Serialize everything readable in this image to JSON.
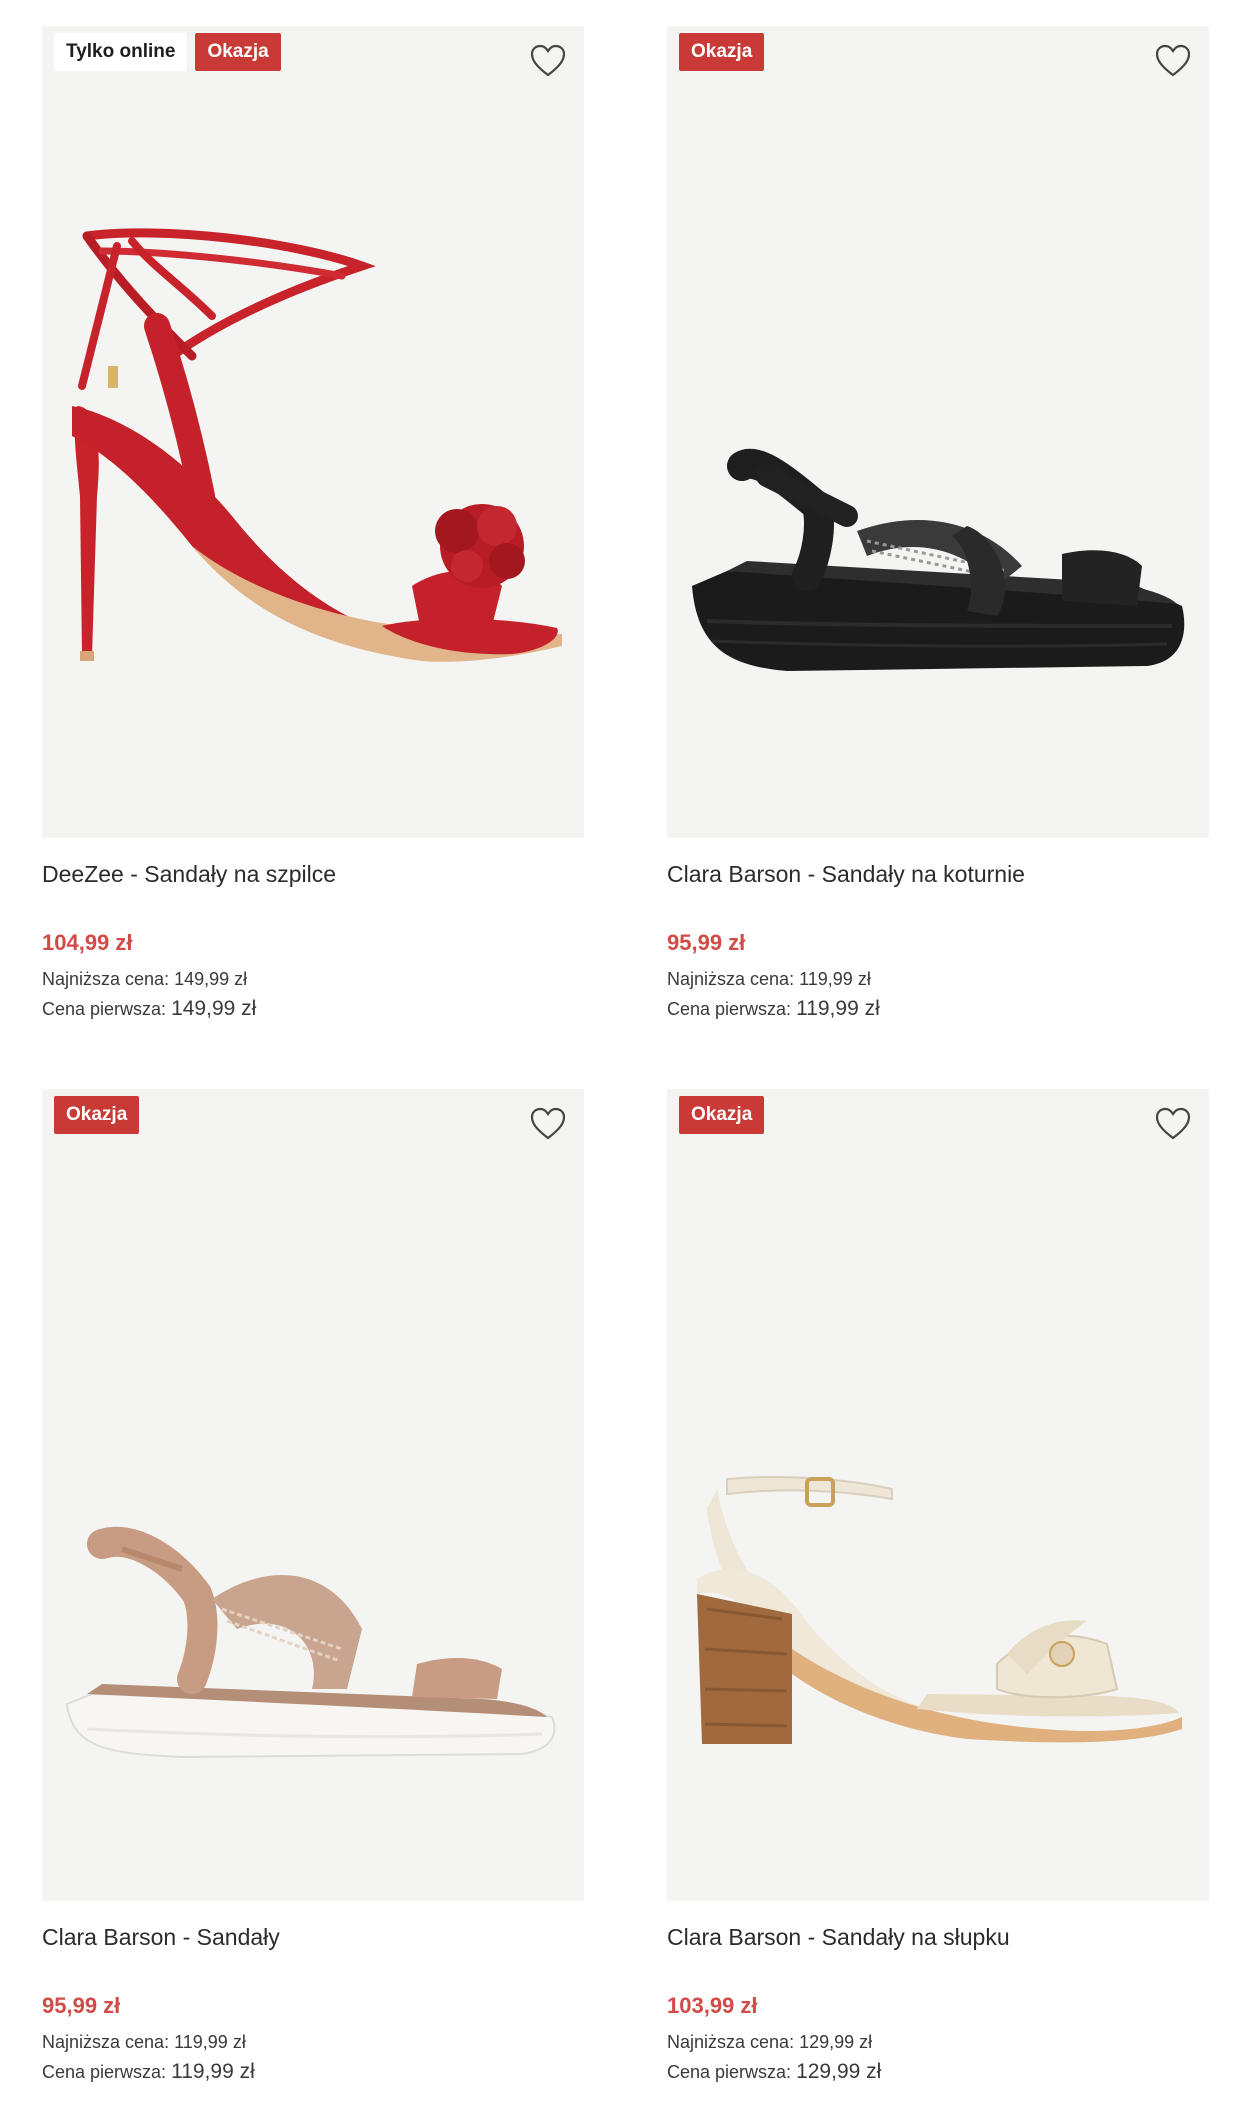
{
  "products": [
    {
      "name": "DeeZee - Sandały na szpilce",
      "badges": [
        "Tylko online",
        "Okazja"
      ],
      "price": "104,99 zł",
      "lowest_label": "Najniższa cena:",
      "lowest_value": "149,99 zł",
      "first_label": "Cena pierwsza:",
      "first_value": "149,99 zł",
      "favorite_icon": "heart-outline-icon"
    },
    {
      "name": "Clara Barson - Sandały na koturnie",
      "badges": [
        "Okazja"
      ],
      "price": "95,99 zł",
      "lowest_label": "Najniższa cena:",
      "lowest_value": "119,99 zł",
      "first_label": "Cena pierwsza:",
      "first_value": "119,99 zł",
      "favorite_icon": "heart-outline-icon"
    },
    {
      "name": "Clara Barson - Sandały",
      "badges": [
        "Okazja"
      ],
      "price": "95,99 zł",
      "lowest_label": "Najniższa cena:",
      "lowest_value": "119,99 zł",
      "first_label": "Cena pierwsza:",
      "first_value": "119,99 zł",
      "favorite_icon": "heart-outline-icon"
    },
    {
      "name": "Clara Barson - Sandały na słupku",
      "badges": [
        "Okazja"
      ],
      "price": "103,99 zł",
      "lowest_label": "Najniższa cena:",
      "lowest_value": "129,99 zł",
      "first_label": "Cena pierwsza:",
      "first_value": "129,99 zł",
      "favorite_icon": "heart-outline-icon"
    }
  ],
  "colors": {
    "deal_badge": "#c93a37",
    "price": "#d14b47",
    "image_bg": "#f4f4f3"
  }
}
